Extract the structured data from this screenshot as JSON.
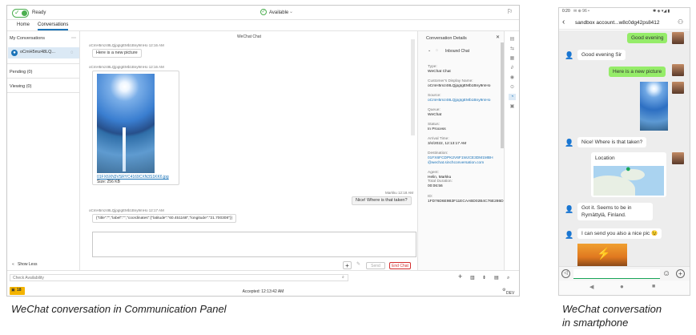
{
  "panel": {
    "status": "Ready",
    "availability": "Available",
    "tabs": [
      "Home",
      "Conversations"
    ],
    "sidebar": {
      "my_conversations": "My Conversations",
      "conversation": "oCmH5mz48LQ...",
      "pending": "Pending (0)",
      "viewing": "Viewing (0)",
      "show_less": "Show Less"
    },
    "chat": {
      "title": "WeChat Chat",
      "msg1_meta": "oCmH5mz48LQjpgIgEMb1Bny9mHo 12:16 AM",
      "msg1": "Here is a new picture",
      "msg2_meta": "oCmH5mz48LQjpgIgEMb1Bny9mHo 12:16 AM",
      "file_link": "01FX6XN3VSRYC4169CXN3S1KK6.jpg",
      "file_size": "Size: 256 KB",
      "msg3_meta": "Markku 12:18 AM",
      "msg3": "Nice! Where is that taken?",
      "msg4_meta": "oCmH5mz48LQjpgIgEMb1Bny9mHo 12:17 AM",
      "msg4": "{\"title\":\"\",\"label\":\"\",\"coordinates\":{\"latitude\":\"60.451168\",\"longitude\":\"21.700308\"}}",
      "send": "Send",
      "end_chat": "End Chat"
    },
    "details": {
      "header": "Conversation Details",
      "section": "Inbound Chat",
      "fields": [
        {
          "label": "Type:",
          "value": "WeChat Chat",
          "link": false
        },
        {
          "label": "Customer's Display Name:",
          "value": "oCmH5mz48LQjpgIgEMb1Bny9mHo",
          "link": false
        },
        {
          "label": "Source:",
          "value": "oCmH5mz48LQjpgIgEMb1Bny9mHo",
          "link": true
        },
        {
          "label": "Queue:",
          "value": "WeChat",
          "link": false
        },
        {
          "label": "Status:",
          "value": "In Process",
          "link": false
        },
        {
          "label": "Arrival Time:",
          "value": "3/4/2022, 12:13:17 AM",
          "link": false
        },
        {
          "label": "Destination:",
          "value": "01FX6FCDPK2V6F1WJCE3DM1MBH @wechat.sinchconversation.com",
          "link": true
        },
        {
          "label": "Agent:",
          "value": "Helin, Markku",
          "link": false
        },
        {
          "label": "Total Duration:",
          "value": "00:06:56",
          "link": false
        },
        {
          "label": "ID:",
          "value": "1FD76D6E9B3F11ECAABD02B4C76E286D",
          "link": false
        }
      ]
    },
    "footer": {
      "check_availability": "Check Availability",
      "badge": "18",
      "accepted": "Accepted: 12:13:42 AM",
      "dev": "DEV"
    }
  },
  "phone": {
    "status_time": "0:20",
    "status_icons": "✉ ⊕ 96  •",
    "status_right": "✱ ◈ ▾◢ ▮",
    "title": "sandbox account...w8c0dg42ps8412",
    "messages": {
      "good_evening": "Good evening",
      "good_evening_sir": "Good evening Sir",
      "new_picture": "Here is a new picture",
      "where": "Nice! Where is that taken?",
      "location": "Location",
      "got_it": "Got it. Seems to be in Rymättylä, Finland.",
      "nice_pic": "I can send you also a nice pic 😉"
    }
  },
  "captions": {
    "left": "WeChat conversation in Communication Panel",
    "right_line1": "WeChat conversation",
    "right_line2": "in smartphone"
  },
  "colors": {
    "accent": "#1a73b8",
    "wechat_green": "#95ec69",
    "ready_green": "#4caf50",
    "end_chat": "#d32f2f"
  }
}
